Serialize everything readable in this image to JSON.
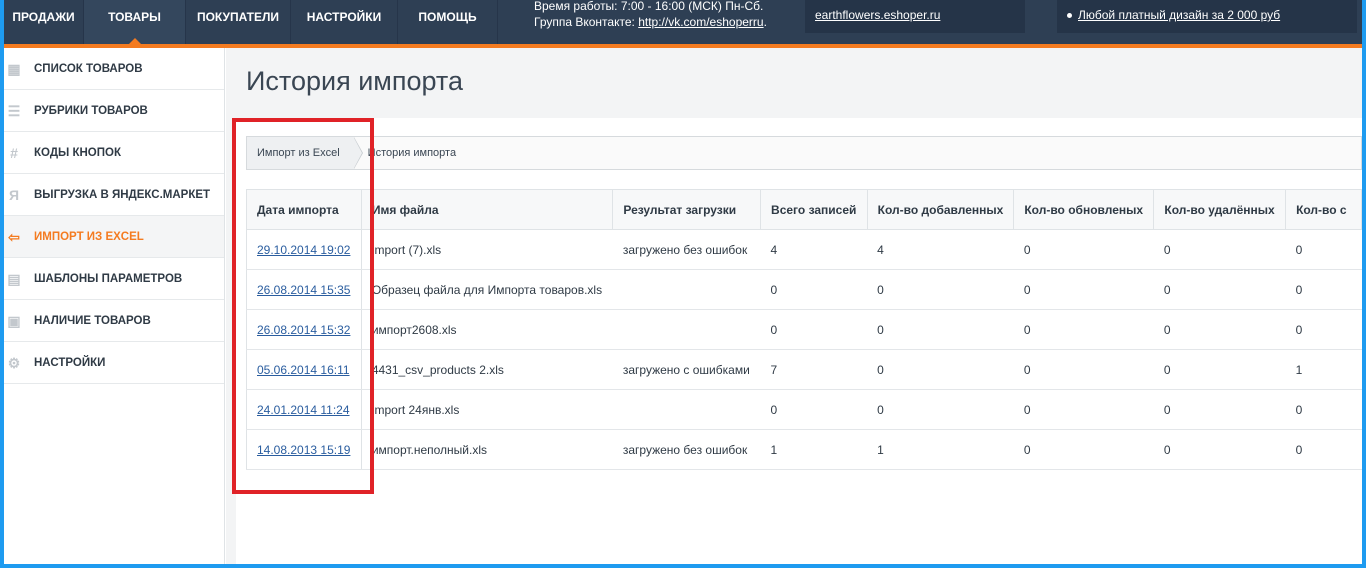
{
  "nav": {
    "items": [
      "ПРОДАЖИ",
      "ТОВАРЫ",
      "ПОКУПАТЕЛИ",
      "НАСТРОЙКИ",
      "ПОМОЩЬ"
    ],
    "active": "ТОВАРЫ"
  },
  "header_info": {
    "work_hours": "Время работы: 7:00 - 16:00 (МСК) Пн-Сб.",
    "vk_label": "Группа Вконтакте:",
    "vk_link": "http://vk.com/eshoperru",
    "shop_link": "earthflowers.eshoper.ru",
    "promo": "Любой платный дизайн за 2 000 руб"
  },
  "sidebar": {
    "items": [
      {
        "label": "СПИСОК ТОВАРОВ",
        "icon": "grid-icon"
      },
      {
        "label": "РУБРИКИ ТОВАРОВ",
        "icon": "list-icon"
      },
      {
        "label": "КОДЫ КНОПОК",
        "icon": "hash-icon"
      },
      {
        "label": "ВЫГРУЗКА В ЯНДЕКС.МАРКЕТ",
        "icon": "yandex-icon"
      },
      {
        "label": "ИМПОРТ ИЗ EXCEL",
        "icon": "import-icon",
        "active": true
      },
      {
        "label": "ШАБЛОНЫ ПАРАМЕТРОВ",
        "icon": "template-icon"
      },
      {
        "label": "НАЛИЧИЕ ТОВАРОВ",
        "icon": "truck-icon"
      },
      {
        "label": "НАСТРОЙКИ",
        "icon": "gear-icon"
      }
    ]
  },
  "page_title": "История импорта",
  "breadcrumb": {
    "parent": "Импорт из Excel",
    "current": "История импорта"
  },
  "table": {
    "columns": [
      "Дата импорта",
      "Имя файла",
      "Результат загрузки",
      "Всего записей",
      "Кол-во добавленных",
      "Кол-во обновленых",
      "Кол-во удалённых",
      "Кол-во с"
    ],
    "rows": [
      [
        "29.10.2014 19:02",
        "import (7).xls",
        "загружено без ошибок",
        "4",
        "4",
        "0",
        "0",
        "0"
      ],
      [
        "26.08.2014 15:35",
        "Образец файла для Импорта товаров.xls",
        "",
        "0",
        "0",
        "0",
        "0",
        "0"
      ],
      [
        "26.08.2014 15:32",
        "импорт2608.xls",
        "",
        "0",
        "0",
        "0",
        "0",
        "0"
      ],
      [
        "05.06.2014 16:11",
        "4431_csv_products 2.xls",
        "загружено с ошибками",
        "7",
        "0",
        "0",
        "0",
        "1"
      ],
      [
        "24.01.2014 11:24",
        "import 24янв.xls",
        "",
        "0",
        "0",
        "0",
        "0",
        "0"
      ],
      [
        "14.08.2013 15:19",
        "импорт.неполный.xls",
        "загружено без ошибок",
        "1",
        "1",
        "0",
        "0",
        "0"
      ]
    ]
  },
  "colors": {
    "nav_bg": "#2e3f54",
    "accent": "#f47b20",
    "link": "#2a5d9f",
    "highlight": "#e02227",
    "frame": "#1e9bf0"
  }
}
